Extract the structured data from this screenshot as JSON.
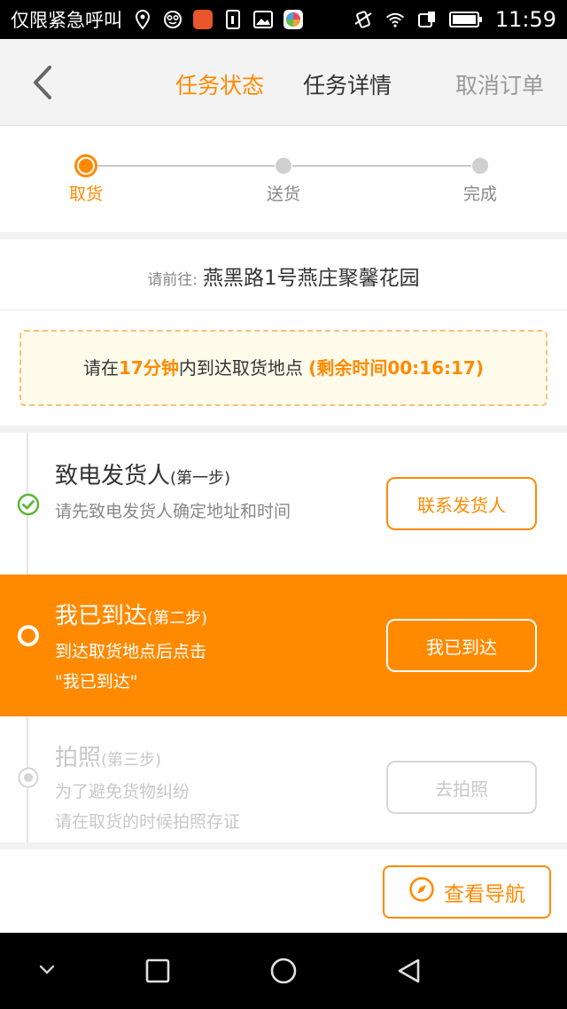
{
  "statusbar": {
    "carrier": "仅限紧急呼叫",
    "time": "11:59",
    "left_icons": [
      "location-icon",
      "face-icon",
      "app-red-icon",
      "sim-icon",
      "image-icon",
      "app-color-icon"
    ],
    "right_icons": [
      "vibrate-icon",
      "wifi-icon",
      "data-icon",
      "battery-icon"
    ]
  },
  "header": {
    "tab_status": "任务状态",
    "tab_detail": "任务详情",
    "cancel": "取消订单"
  },
  "progress": {
    "steps": [
      {
        "label": "取货",
        "active": true
      },
      {
        "label": "送货",
        "active": false
      },
      {
        "label": "完成",
        "active": false
      }
    ]
  },
  "address": {
    "prefix": "请前往:",
    "value": "燕黑路1号燕庄聚馨花园"
  },
  "notice": {
    "part1": "请在",
    "minutes": "17分钟",
    "part2": "内到达取货地点",
    "remaining": "(剩余时间00:16:17)"
  },
  "steps": [
    {
      "title": "致电发货人",
      "sub": "(第一步)",
      "desc": [
        "请先致电发货人确定地址和时间"
      ],
      "button": "联系发货人",
      "state": "done"
    },
    {
      "title": "我已到达",
      "sub": "(第二步)",
      "desc": [
        "到达取货地点后点击",
        "\"我已到达\""
      ],
      "button": "我已到达",
      "state": "current"
    },
    {
      "title": "拍照",
      "sub": "(第三步)",
      "desc": [
        "为了避免货物纠纷",
        "请在取货的时候拍照存证"
      ],
      "button": "去拍照",
      "state": "pending"
    }
  ],
  "footer": {
    "nav_button": "查看导航"
  },
  "colors": {
    "accent": "#ff8a00",
    "done": "#5cb531"
  }
}
